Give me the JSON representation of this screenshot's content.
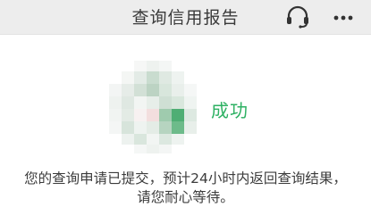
{
  "header": {
    "title": "查询信用报告",
    "support_icon": "headset-icon",
    "more_icon": "ellipsis-icon"
  },
  "result": {
    "avatar_icon": "pixelated-avatar",
    "status": "成功",
    "status_color": "#2eb163",
    "message": "您的查询申请已提交，预计24小时内返回查询结果，请您耐心等待。"
  }
}
